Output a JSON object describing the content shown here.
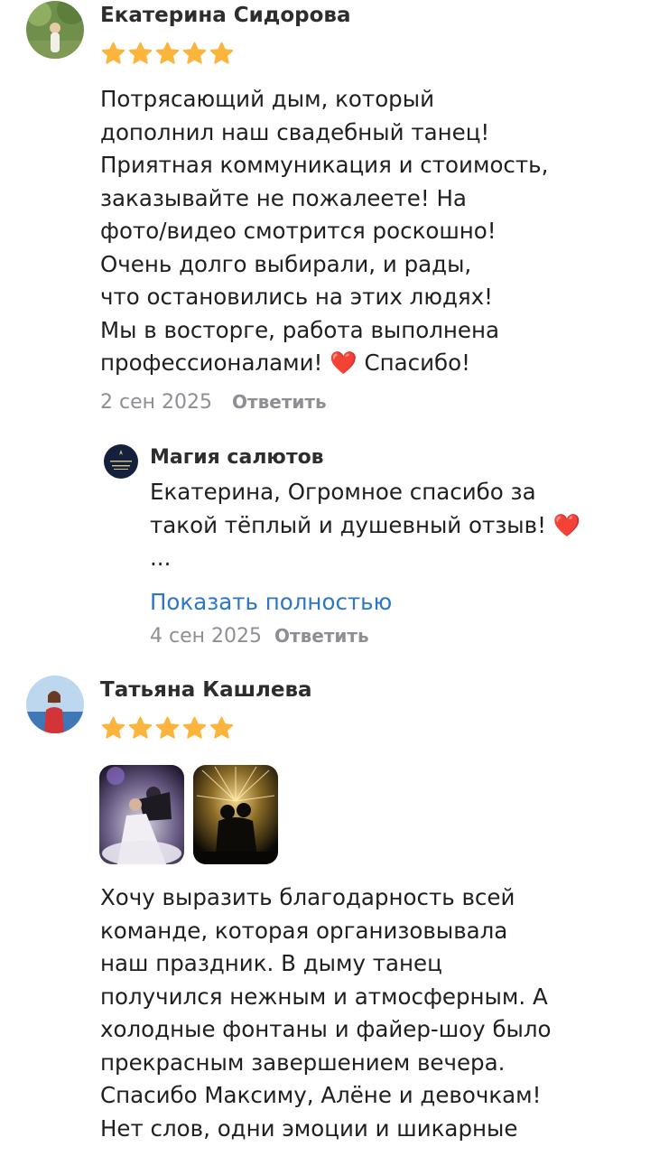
{
  "reviews": [
    {
      "author": "Екатерина Сидорова",
      "rating": 5,
      "text": "Потрясающий дым, который\nдополнил наш свадебный танец!\nПриятная коммуникация и стоимость,\nзаказывайте не пожалеете! На\nфото/видео смотрится роскошно!\nОчень долго выбирали, и рады,\nчто остановились на этих людях!\nМы в восторге, работа выполнена\nпрофессионалами! ❤️ Спасибо!",
      "date": "2 сен 2025",
      "reply_label": "Ответить",
      "company_reply": {
        "name": "Магия салютов",
        "avatar_text": "МАГИЯ САЛЮТОВ",
        "text": "Екатерина, Огромное спасибо за\nтакой тёплый и душевный отзыв! ❤️\n...",
        "show_more": "Показать полностью",
        "date": "4 сен 2025",
        "reply_label": "Ответить"
      }
    },
    {
      "author": "Татьяна Кашлева",
      "rating": 5,
      "photos": [
        "wedding-dance-smoke-photo",
        "cold-fountains-couple-photo"
      ],
      "text": "Хочу выразить благодарность всей\nкоманде, которая организовывала\nнаш праздник. В дыму танец\nполучился нежным и атмосферным. А\nхолодные фонтаны и файер-шоу было\nпрекрасным завершением вечера.\nСпасибо Максиму, Алёне и девочкам!\nНет слов, одни эмоции и шикарные"
    }
  ],
  "colors": {
    "star": "#fbb53c",
    "link": "#2a76c9",
    "secondary": "#8d8f94"
  }
}
